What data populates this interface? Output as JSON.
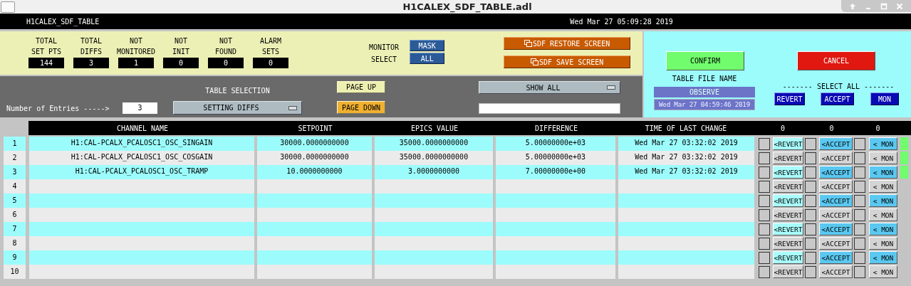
{
  "window": {
    "title": "H1CALEX_SDF_TABLE.adl"
  },
  "header": {
    "screen_name": "H1CALEX_SDF_TABLE",
    "datetime": "Wed Mar 27 05:09:28 2019"
  },
  "stats": [
    {
      "label_lines": [
        "TOTAL",
        "SET PTS"
      ],
      "value": "144"
    },
    {
      "label_lines": [
        "TOTAL",
        "DIFFS"
      ],
      "value": "3"
    },
    {
      "label_lines": [
        "NOT",
        "MONITORED"
      ],
      "value": "1"
    },
    {
      "label_lines": [
        "NOT",
        "INIT"
      ],
      "value": "0"
    },
    {
      "label_lines": [
        "NOT",
        "FOUND"
      ],
      "value": "0"
    },
    {
      "label_lines": [
        "ALARM",
        "SETS"
      ],
      "value": "0"
    }
  ],
  "monitor_select": {
    "label_lines": [
      "MONITOR",
      "SELECT"
    ],
    "options": [
      "MASK",
      "ALL"
    ]
  },
  "screen_buttons": [
    "SDF RESTORE SCREEN",
    "SDF SAVE SCREEN"
  ],
  "actions": [
    {
      "kind": "confirm",
      "label": "CONFIRM"
    },
    {
      "kind": "cancel",
      "label": "CANCEL"
    }
  ],
  "table_file": {
    "label": "TABLE FILE NAME",
    "name": "OBSERVE",
    "datetime": "Wed Mar 27 04:59:46 2019"
  },
  "select_all": {
    "label": "------- SELECT ALL -------",
    "buttons": [
      "REVERT",
      "ACCEPT",
      "MON"
    ]
  },
  "entries": {
    "label": "Number of Entries ----->",
    "value": "3"
  },
  "table_selection": {
    "label": "TABLE SELECTION",
    "value": "SETTING DIFFS"
  },
  "page_buttons": [
    {
      "kind": "up",
      "label": "PAGE UP"
    },
    {
      "kind": "down",
      "label": "PAGE DOWN"
    }
  ],
  "filter": {
    "value": "SHOW ALL"
  },
  "table": {
    "columns": [
      "CHANNEL NAME",
      "SETPOINT",
      "EPICS VALUE",
      "DIFFERENCE",
      "TIME OF LAST CHANGE"
    ],
    "counts": [
      "0",
      "0",
      "0"
    ],
    "rows": [
      {
        "number": "1",
        "channel": "H1:CAL-PCALX_PCALOSC1_OSC_SINGAIN",
        "setpoint": "30000.0000000000",
        "epics_value": "35000.0000000000",
        "difference": "5.00000000e+03",
        "time": "Wed Mar 27 03:32:02 2019",
        "revert": {
          "label": "<REVERT",
          "checked": false
        },
        "accept": {
          "label": "<ACCEPT",
          "checked": false
        },
        "mon": {
          "label": "< MON",
          "checked": false
        },
        "indicator": true
      },
      {
        "number": "2",
        "channel": "H1:CAL-PCALX_PCALOSC1_OSC_COSGAIN",
        "setpoint": "30000.0000000000",
        "epics_value": "35000.0000000000",
        "difference": "5.00000000e+03",
        "time": "Wed Mar 27 03:32:02 2019",
        "revert": {
          "label": "<REVERT",
          "checked": false
        },
        "accept": {
          "label": "<ACCEPT",
          "checked": false
        },
        "mon": {
          "label": "< MON",
          "checked": false
        },
        "indicator": true
      },
      {
        "number": "3",
        "channel": "H1:CAL-PCALX_PCALOSC1_OSC_TRAMP",
        "setpoint": "10.0000000000",
        "epics_value": "3.0000000000",
        "difference": "7.00000000e+00",
        "time": "Wed Mar 27 03:32:02 2019",
        "revert": {
          "label": "<REVERT",
          "checked": false
        },
        "accept": {
          "label": "<ACCEPT",
          "checked": false
        },
        "mon": {
          "label": "< MON",
          "checked": false
        },
        "indicator": true
      },
      {
        "number": "4",
        "revert": {
          "label": "<REVERT",
          "checked": false
        },
        "accept": {
          "label": "<ACCEPT",
          "checked": false
        },
        "mon": {
          "label": "< MON",
          "checked": false
        },
        "indicator": false
      },
      {
        "number": "5",
        "revert": {
          "label": "<REVERT",
          "checked": false
        },
        "accept": {
          "label": "<ACCEPT",
          "checked": false
        },
        "mon": {
          "label": "< MON",
          "checked": false
        },
        "indicator": false
      },
      {
        "number": "6",
        "revert": {
          "label": "<REVERT",
          "checked": false
        },
        "accept": {
          "label": "<ACCEPT",
          "checked": false
        },
        "mon": {
          "label": "< MON",
          "checked": false
        },
        "indicator": false
      },
      {
        "number": "7",
        "revert": {
          "label": "<REVERT",
          "checked": false
        },
        "accept": {
          "label": "<ACCEPT",
          "checked": false
        },
        "mon": {
          "label": "< MON",
          "checked": false
        },
        "indicator": false
      },
      {
        "number": "8",
        "revert": {
          "label": "<REVERT",
          "checked": false
        },
        "accept": {
          "label": "<ACCEPT",
          "checked": false
        },
        "mon": {
          "label": "< MON",
          "checked": false
        },
        "indicator": false
      },
      {
        "number": "9",
        "revert": {
          "label": "<REVERT",
          "checked": false
        },
        "accept": {
          "label": "<ACCEPT",
          "checked": false
        },
        "mon": {
          "label": "< MON",
          "checked": false
        },
        "indicator": false
      },
      {
        "number": "10",
        "revert": {
          "label": "<REVERT",
          "checked": false
        },
        "accept": {
          "label": "<ACCEPT",
          "checked": false
        },
        "mon": {
          "label": "< MON",
          "checked": false
        },
        "indicator": false
      }
    ]
  }
}
